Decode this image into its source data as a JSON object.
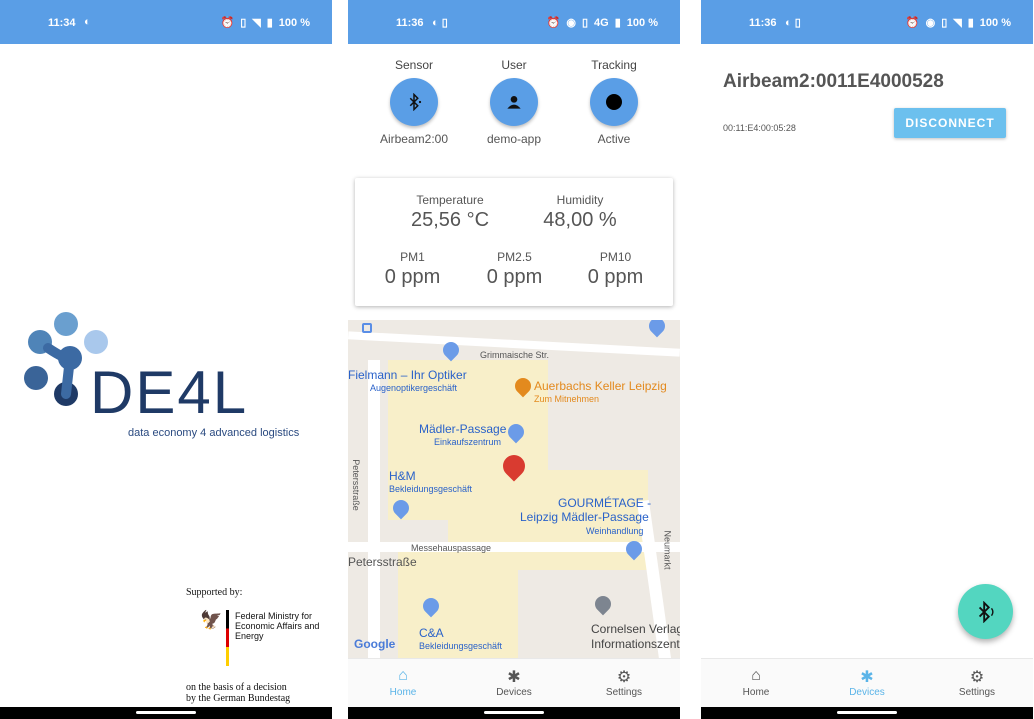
{
  "screen1": {
    "status": {
      "time": "11:34",
      "battery": "100 %"
    },
    "logo_text": "DE4L",
    "logo_sub": "data economy 4 advanced logistics",
    "supported_by": "Supported by:",
    "ministry": "Federal Ministry for Economic Affairs and Energy",
    "decision_line1": "on the basis of a decision",
    "decision_line2": "by the German Bundestag"
  },
  "screen2": {
    "status": {
      "time": "11:36",
      "network": "4G",
      "battery": "100 %"
    },
    "sensor": {
      "label": "Sensor",
      "value": "Airbeam2:00"
    },
    "user": {
      "label": "User",
      "value": "demo-app"
    },
    "tracking": {
      "label": "Tracking",
      "value": "Active"
    },
    "temperature": {
      "label": "Temperature",
      "value": "25,56 °C"
    },
    "humidity": {
      "label": "Humidity",
      "value": "48,00  %"
    },
    "pm1": {
      "label": "PM1",
      "value": "0 ppm"
    },
    "pm25": {
      "label": "PM2.5",
      "value": "0 ppm"
    },
    "pm10": {
      "label": "PM10",
      "value": "0 ppm"
    },
    "map": {
      "street1": "Grimmaische Str.",
      "fielmann": "Fielmann – Ihr Optiker",
      "fielmann_sub": "Augenoptikergeschäft",
      "auerbach": "Auerbachs Keller Leipzig",
      "auerbach_sub": "Zum Mitnehmen",
      "maedler": "Mädler-Passage",
      "maedler_sub": "Einkaufszentrum",
      "hm": "H&M",
      "hm_sub": "Bekleidungsgeschäft",
      "gourmetage": "GOURMÉTAGE -",
      "gourmetage2": "Leipzig Mädler-Passage",
      "gourmetage_sub": "Weinhandlung",
      "petersstr_v": "Petersstraße",
      "messehaus": "Messehauspassage",
      "petersstr": "Petersstraße",
      "neumarkt": "Neumarkt",
      "ca": "C&A",
      "ca_sub": "Bekleidungsgeschäft",
      "cornelsen": "Cornelsen Verlag",
      "cornelsen2": "Informationszent",
      "google": "Google"
    },
    "nav": {
      "home": "Home",
      "devices": "Devices",
      "settings": "Settings"
    }
  },
  "screen3": {
    "status": {
      "time": "11:36",
      "battery": "100 %"
    },
    "device_name": "Airbeam2:0011E4000528",
    "device_mac": "00:11:E4:00:05:28",
    "disconnect": "DISCONNECT",
    "nav": {
      "home": "Home",
      "devices": "Devices",
      "settings": "Settings"
    }
  },
  "colors": {
    "status_bar": "#5a9ee6",
    "accent": "#5ab4e8",
    "fab": "#53d6c0"
  }
}
